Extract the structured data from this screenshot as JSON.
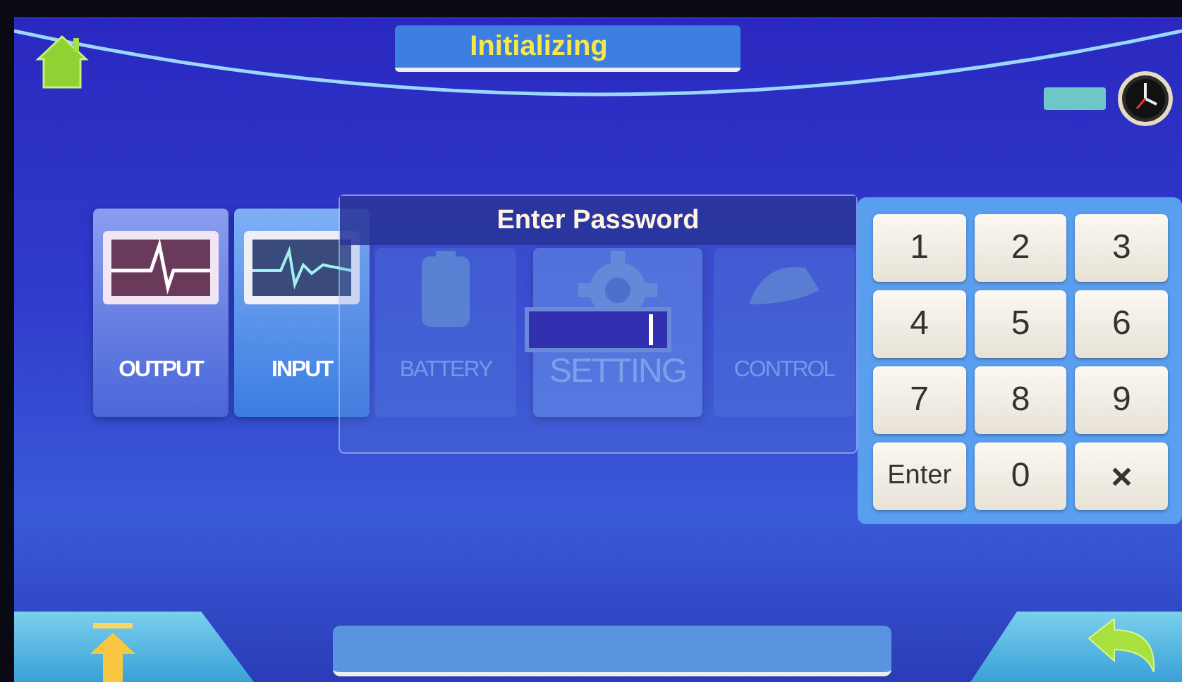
{
  "header": {
    "title": "Initializing"
  },
  "menu": {
    "items": [
      {
        "label": "OUTPUT",
        "kind": "output",
        "selected": false
      },
      {
        "label": "INPUT",
        "kind": "input",
        "selected": false
      },
      {
        "label": "BATTERY",
        "kind": "battery",
        "selected": false
      },
      {
        "label": "SETTING",
        "kind": "setting",
        "selected": true
      },
      {
        "label": "CONTROL",
        "kind": "control",
        "selected": false
      }
    ]
  },
  "password_dialog": {
    "title": "Enter Password"
  },
  "keypad": {
    "keys": [
      {
        "label": "1",
        "kind": "digit"
      },
      {
        "label": "2",
        "kind": "digit"
      },
      {
        "label": "3",
        "kind": "digit"
      },
      {
        "label": "4",
        "kind": "digit"
      },
      {
        "label": "5",
        "kind": "digit"
      },
      {
        "label": "6",
        "kind": "digit"
      },
      {
        "label": "7",
        "kind": "digit"
      },
      {
        "label": "8",
        "kind": "digit"
      },
      {
        "label": "9",
        "kind": "digit"
      },
      {
        "label": "Enter",
        "kind": "enter"
      },
      {
        "label": "0",
        "kind": "digit"
      },
      {
        "label": "×",
        "kind": "clear"
      }
    ]
  }
}
